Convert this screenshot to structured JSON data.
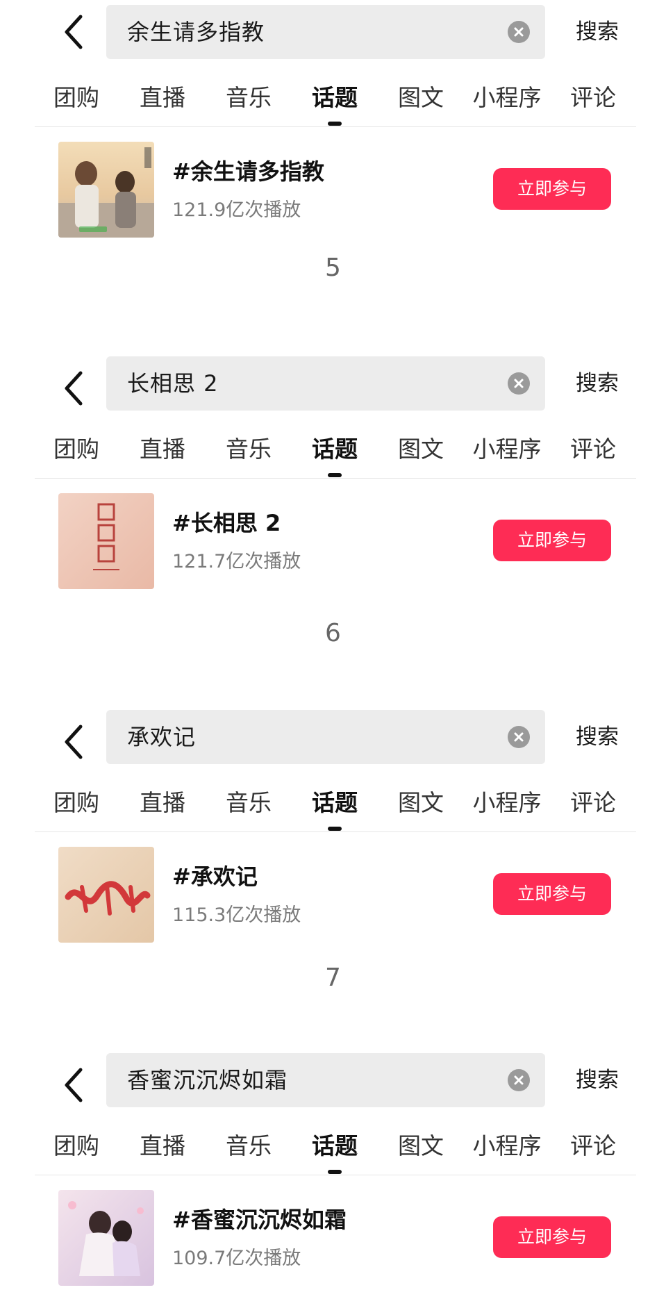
{
  "tabs": [
    "团购",
    "直播",
    "音乐",
    "话题",
    "图文",
    "小程序",
    "评论"
  ],
  "active_tab": "话题",
  "search_button_label": "搜索",
  "join_button_label": "立即参与",
  "panels": [
    {
      "query": "余生请多指教",
      "result": {
        "title": "#余生请多指教",
        "plays": "121.9亿次播放"
      },
      "page_number": "5"
    },
    {
      "query": "长相思 2",
      "result": {
        "title": "#长相思 2",
        "plays": "121.7亿次播放"
      },
      "page_number": "6"
    },
    {
      "query": "承欢记",
      "result": {
        "title": "#承欢记",
        "plays": "115.3亿次播放"
      },
      "page_number": "7"
    },
    {
      "query": "香蜜沉沉烬如霜",
      "result": {
        "title": "#香蜜沉沉烬如霜",
        "plays": "109.7亿次播放"
      },
      "page_number": ""
    }
  ],
  "colors": {
    "accent": "#fe2c55",
    "search_bg": "#ececec",
    "divider": "#e6e6e6"
  },
  "icons": {
    "back": "chevron-left-icon",
    "clear": "close-circle-icon"
  }
}
